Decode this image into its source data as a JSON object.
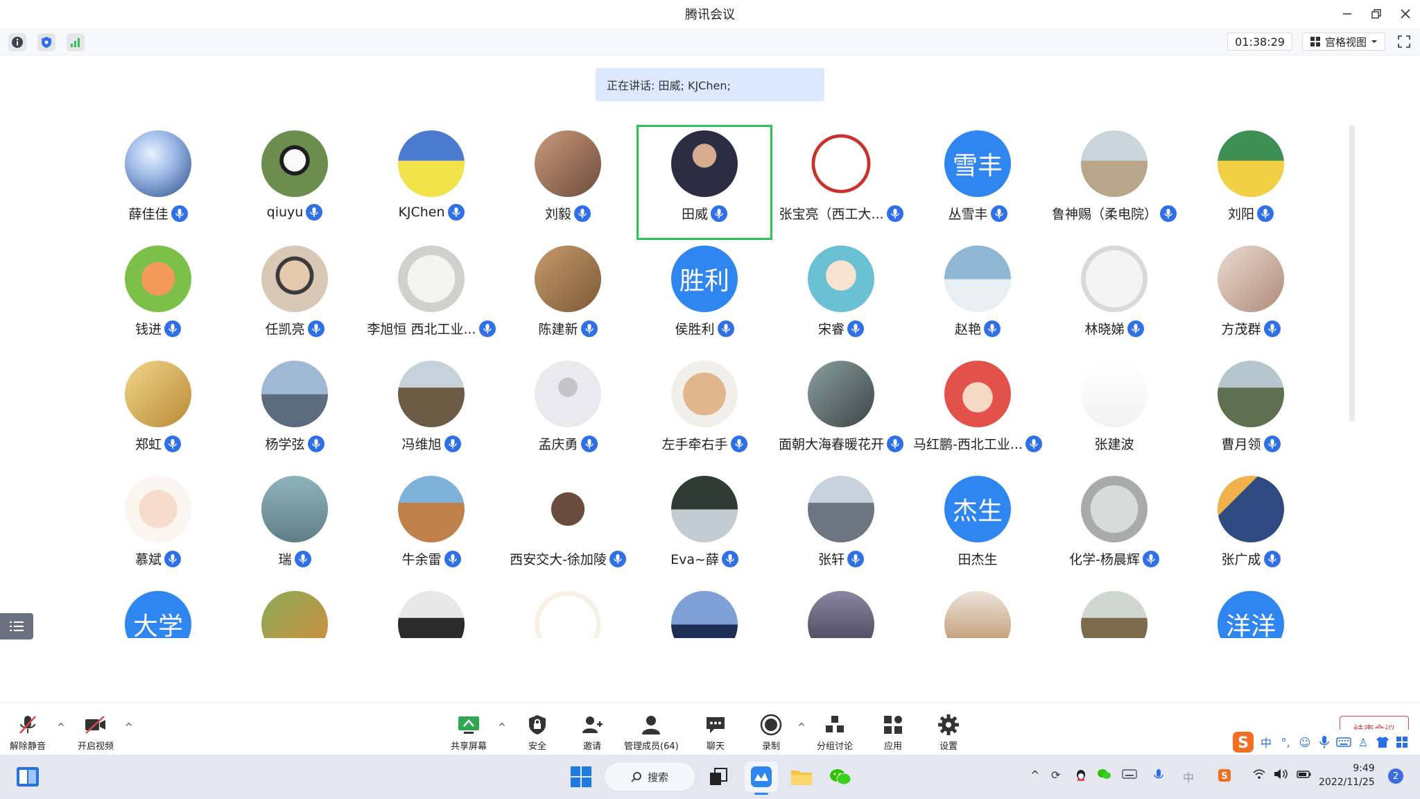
{
  "window": {
    "title": "腾讯会议"
  },
  "toolbar": {
    "timer": "01:38:29",
    "view_label": "宫格视图"
  },
  "speaking": {
    "text": "正在讲话: 田威; KJChen;"
  },
  "participants": [
    {
      "name": "薛佳佳",
      "avatar": "sky",
      "color": "#6d8fc7"
    },
    {
      "name": "qiuyu",
      "avatar": "panda",
      "color": "#55704a"
    },
    {
      "name": "KJChen",
      "avatar": "field",
      "color": "#4a7bd0"
    },
    {
      "name": "刘毅",
      "avatar": "family",
      "color": "#9a6a55"
    },
    {
      "name": "田威",
      "avatar": "man",
      "color": "#3d3f55"
    },
    {
      "name": "张宝亮（西工大...",
      "avatar": "redframe",
      "color": "#b84a42"
    },
    {
      "name": "丛雪丰",
      "avatar": "text",
      "text": "雪丰",
      "color": "#2f86f0"
    },
    {
      "name": "鲁神赐（柔电院）",
      "avatar": "beach",
      "color": "#aebfc6"
    },
    {
      "name": "刘阳",
      "avatar": "cartoon",
      "color": "#c9a24a"
    },
    {
      "name": "钱进",
      "avatar": "monkey",
      "color": "#e06a3a"
    },
    {
      "name": "任凯亮",
      "avatar": "boy",
      "color": "#d6c2ad"
    },
    {
      "name": "李旭恒  西北工业...",
      "avatar": "sketch",
      "color": "#cfd2cc"
    },
    {
      "name": "陈建新",
      "avatar": "wood",
      "color": "#a47a4f"
    },
    {
      "name": "侯胜利",
      "avatar": "text",
      "text": "胜利",
      "color": "#2f86f0"
    },
    {
      "name": "宋睿",
      "avatar": "anime",
      "color": "#7cc9c8"
    },
    {
      "name": "赵艳",
      "avatar": "wedding",
      "color": "#7fa8c4"
    },
    {
      "name": "林晓娣",
      "avatar": "grey",
      "color": "#c9c9c9"
    },
    {
      "name": "方茂群",
      "avatar": "woman",
      "color": "#c6a99a"
    },
    {
      "name": "郑虹",
      "avatar": "goldkid",
      "color": "#d8b45e"
    },
    {
      "name": "杨学弦",
      "avatar": "city",
      "color": "#7d95b3"
    },
    {
      "name": "冯维旭",
      "avatar": "bridge",
      "color": "#8c7a55"
    },
    {
      "name": "孟庆勇",
      "avatar": "default",
      "color": "#e6e7e9"
    },
    {
      "name": "左手牵右手",
      "avatar": "smile",
      "color": "#c9a078"
    },
    {
      "name": "面朝大海春暖花开",
      "avatar": "girl",
      "color": "#5e6b6a"
    },
    {
      "name": "马红鹏-西北工业...",
      "avatar": "doll",
      "color": "#e27b74"
    },
    {
      "name": "张建波",
      "avatar": "calli",
      "color": "#f4f4f4",
      "nomic": true
    },
    {
      "name": "曹月领",
      "avatar": "wall",
      "color": "#6f7f5e"
    },
    {
      "name": "慕斌",
      "avatar": "baby",
      "color": "#f0e0d6"
    },
    {
      "name": "瑞",
      "avatar": "icecream",
      "color": "#86a9b5"
    },
    {
      "name": "牛余雷",
      "avatar": "rock",
      "color": "#b47c4a"
    },
    {
      "name": "西安交大-徐加陵",
      "avatar": "catgirl",
      "color": "#f5f5f5"
    },
    {
      "name": "Eva~薛",
      "avatar": "house",
      "color": "#6d7f6b"
    },
    {
      "name": "张轩",
      "avatar": "street",
      "color": "#9aa3ad"
    },
    {
      "name": "田杰生",
      "avatar": "text",
      "text": "杰生",
      "color": "#2f86f0",
      "nomic": true
    },
    {
      "name": "化学-杨晨辉",
      "avatar": "mist",
      "color": "#bfc1c1"
    },
    {
      "name": "张广成",
      "avatar": "speaker",
      "color": "#4a5f8a"
    },
    {
      "name": "",
      "avatar": "text",
      "text": "大学",
      "color": "#2f86f0",
      "nomic": true
    },
    {
      "name": "",
      "avatar": "leaves",
      "color": "#b98a52",
      "nomic": true
    },
    {
      "name": "",
      "avatar": "suit",
      "color": "#8f8f8f",
      "nomic": true
    },
    {
      "name": "",
      "avatar": "logo",
      "color": "#fafafa",
      "nomic": true
    },
    {
      "name": "",
      "avatar": "skyline",
      "color": "#3d5a90",
      "nomic": true
    },
    {
      "name": "",
      "avatar": "dusk",
      "color": "#6a6880",
      "nomic": true
    },
    {
      "name": "",
      "avatar": "statue",
      "color": "#c9a47c",
      "nomic": true
    },
    {
      "name": "",
      "avatar": "squirrel",
      "color": "#9a8a6a",
      "nomic": true
    },
    {
      "name": "",
      "avatar": "text",
      "text": "洋洋",
      "color": "#2f86f0",
      "nomic": true
    }
  ],
  "meeting_bar": {
    "unmute": "解除静音",
    "start_video": "开启视频",
    "share_screen": "共享屏幕",
    "security": "安全",
    "invite": "邀请",
    "manage_members": "管理成员(64)",
    "chat": "聊天",
    "record": "录制",
    "breakout": "分组讨论",
    "apps": "应用",
    "settings": "设置",
    "end_meeting": "结束会议"
  },
  "taskbar": {
    "search": "搜索",
    "time": "9:49",
    "date": "2022/11/25",
    "notifications": "2",
    "ime_lang": "中"
  }
}
